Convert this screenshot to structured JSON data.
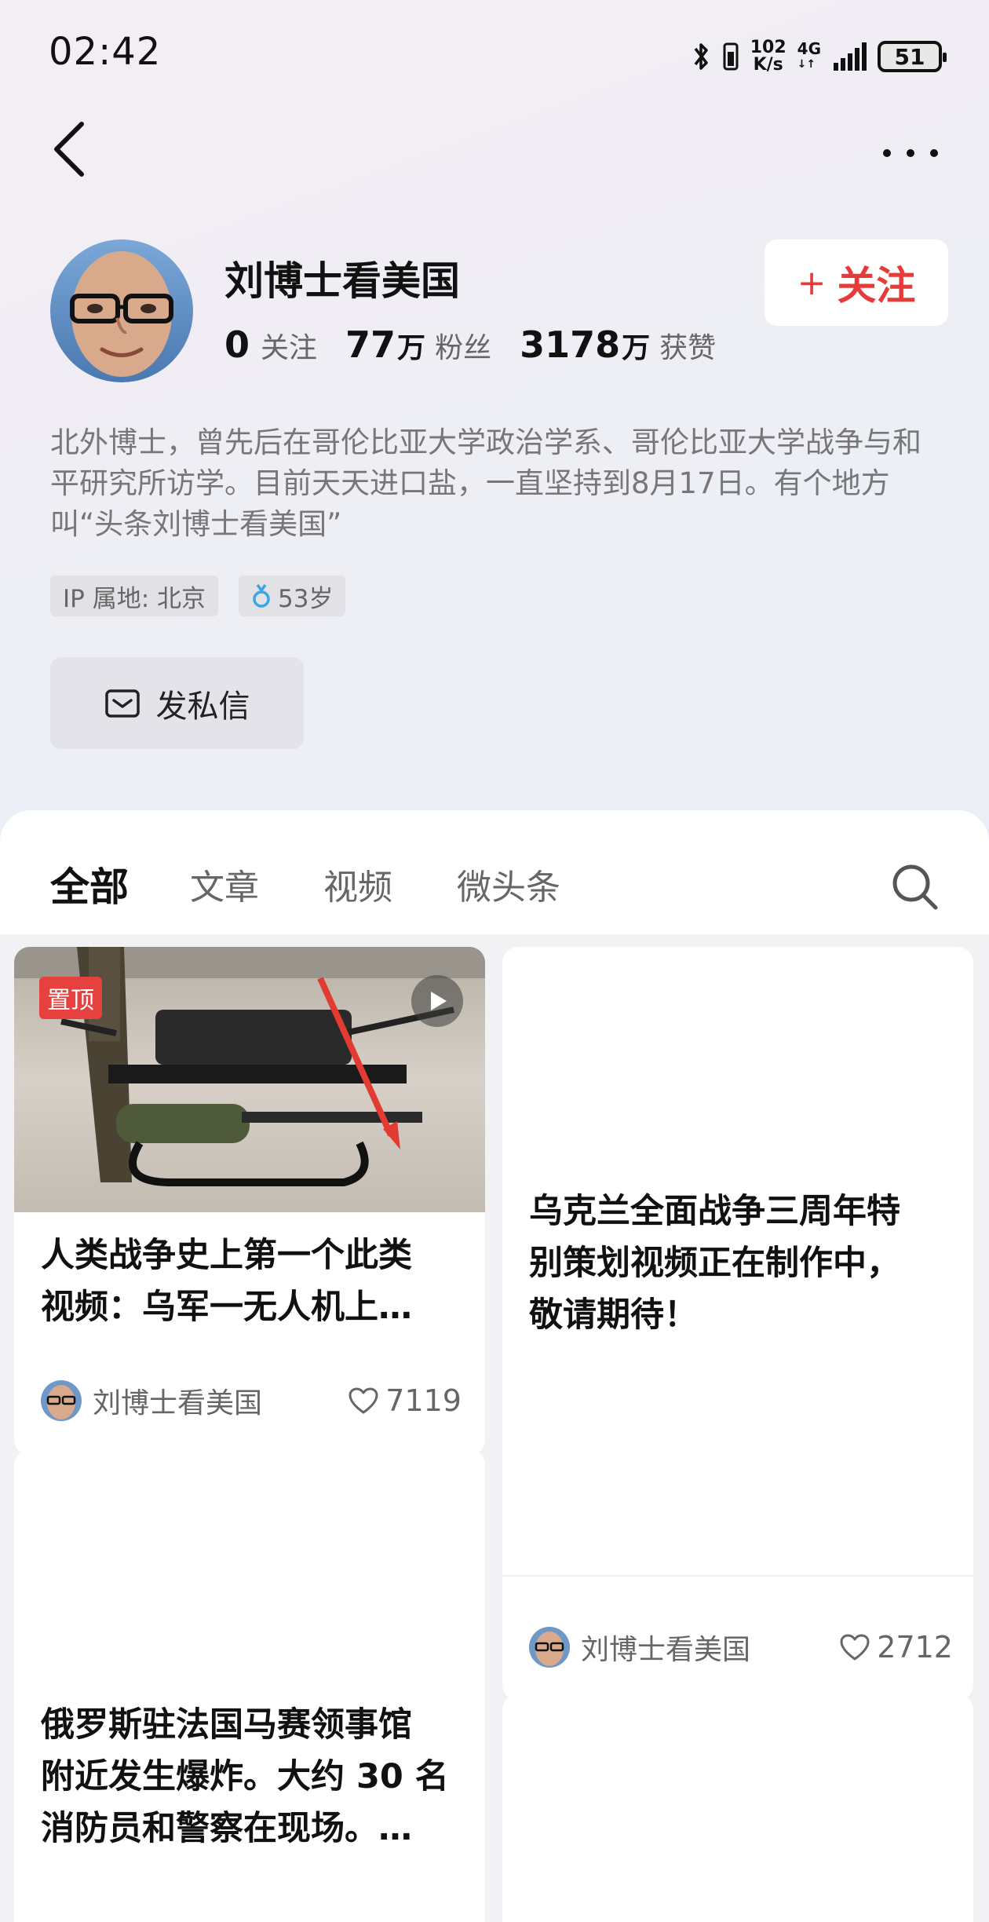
{
  "status": {
    "time": "02:42",
    "speed_value": "102",
    "speed_unit": "K/s",
    "network": "4G",
    "battery": "51"
  },
  "profile": {
    "name": "刘博士看美国",
    "follow_button": "关注",
    "stats": [
      {
        "value": "0",
        "unit": "",
        "label": "关注"
      },
      {
        "value": "77",
        "unit": "万",
        "label": "粉丝"
      },
      {
        "value": "3178",
        "unit": "万",
        "label": "获赞"
      }
    ],
    "bio": "北外博士，曾先后在哥伦比亚大学政治学系、哥伦比亚大学战争与和平研究所访学。目前天天进口盐，一直坚持到8月17日。有个地方叫“头条刘博士看美国”",
    "tags": {
      "ip": "IP 属地: 北京",
      "age": "53岁"
    },
    "message_button": "发私信"
  },
  "tabs": [
    {
      "label": "全部",
      "active": true
    },
    {
      "label": "文章",
      "active": false
    },
    {
      "label": "视频",
      "active": false
    },
    {
      "label": "微头条",
      "active": false
    }
  ],
  "cards": [
    {
      "badge": "置顶",
      "title_line1": "人类战争史上第一个此类",
      "title_line2": "视频：乌军一无人机上…",
      "author": "刘博士看美国",
      "likes": "7119"
    },
    {
      "title_line1": "乌克兰全面战争三周年特",
      "title_line2": "别策划视频正在制作中，",
      "title_line3": "敬请期待！",
      "author": "刘博士看美国",
      "likes": "2712"
    },
    {
      "title_line1": "俄罗斯驻法国马赛领事馆",
      "title_line2": "附近发生爆炸。大约 30 名",
      "title_line3": "消防员和警察在现场。…"
    }
  ],
  "icons": {
    "back": "chevron-left-icon",
    "more": "more-horizontal-icon",
    "search": "search-icon",
    "message": "mail-icon",
    "gender": "male-icon",
    "like": "heart-icon",
    "play": "play-icon"
  },
  "colors": {
    "accent_red": "#e73b3b",
    "badge_red": "#e6403f",
    "gender_blue": "#3aa6e6"
  }
}
